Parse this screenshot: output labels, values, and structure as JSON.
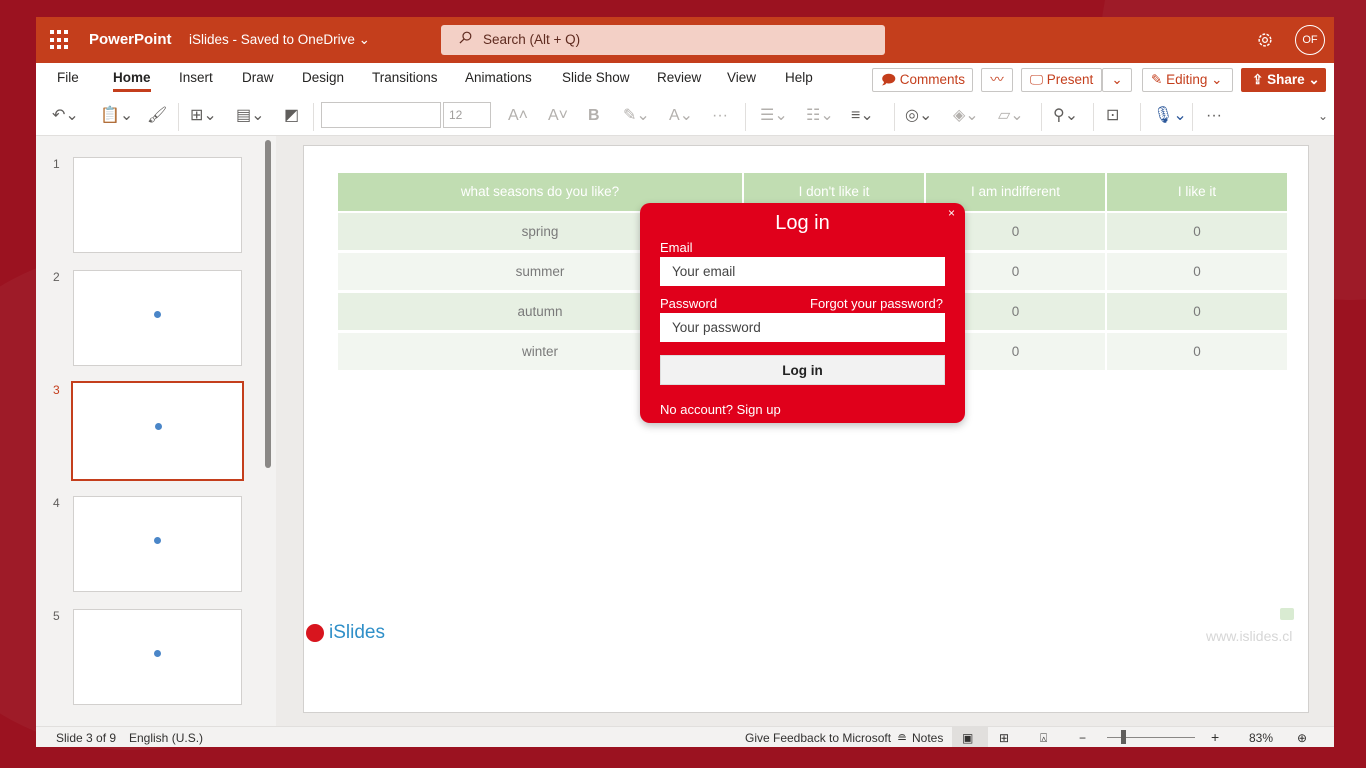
{
  "app": {
    "name": "PowerPoint",
    "document": "iSlides  -  Saved to OneDrive ⌄",
    "search_placeholder": "Search (Alt + Q)",
    "user_initials": "OF"
  },
  "tabs": [
    "File",
    "Home",
    "Insert",
    "Draw",
    "Design",
    "Transitions",
    "Animations",
    "Slide Show",
    "Review",
    "View",
    "Help"
  ],
  "active_tab": "Home",
  "header_buttons": {
    "comments": "Comments",
    "present": "Present",
    "editing": "Editing",
    "share": "Share"
  },
  "ribbon": {
    "font_name": "",
    "font_size": "12"
  },
  "thumbnails": {
    "numbers": [
      "1",
      "2",
      "3",
      "4",
      "5"
    ],
    "selected": "3"
  },
  "slide": {
    "table": {
      "headers": [
        "what seasons do you like?",
        "I don't like it",
        "I am indifferent",
        "I like it"
      ],
      "rows": [
        [
          "spring",
          "",
          "0",
          "0"
        ],
        [
          "summer",
          "",
          "0",
          "0"
        ],
        [
          "autumn",
          "",
          "0",
          "0"
        ],
        [
          "winter",
          "",
          "0",
          "0"
        ]
      ]
    },
    "logo_text": "iSlides",
    "watermark": "www.islides.cl"
  },
  "login_modal": {
    "title": "Log in",
    "close": "×",
    "email_label": "Email",
    "email_placeholder": "Your email",
    "password_label": "Password",
    "forgot": "Forgot your password?",
    "password_placeholder": "Your password",
    "submit": "Log in",
    "signup": "No account? Sign up"
  },
  "status": {
    "slide_info": "Slide 3 of 9",
    "language": "English (U.S.)",
    "feedback": "Give Feedback to Microsoft",
    "notes": "Notes",
    "zoom": "83%"
  }
}
